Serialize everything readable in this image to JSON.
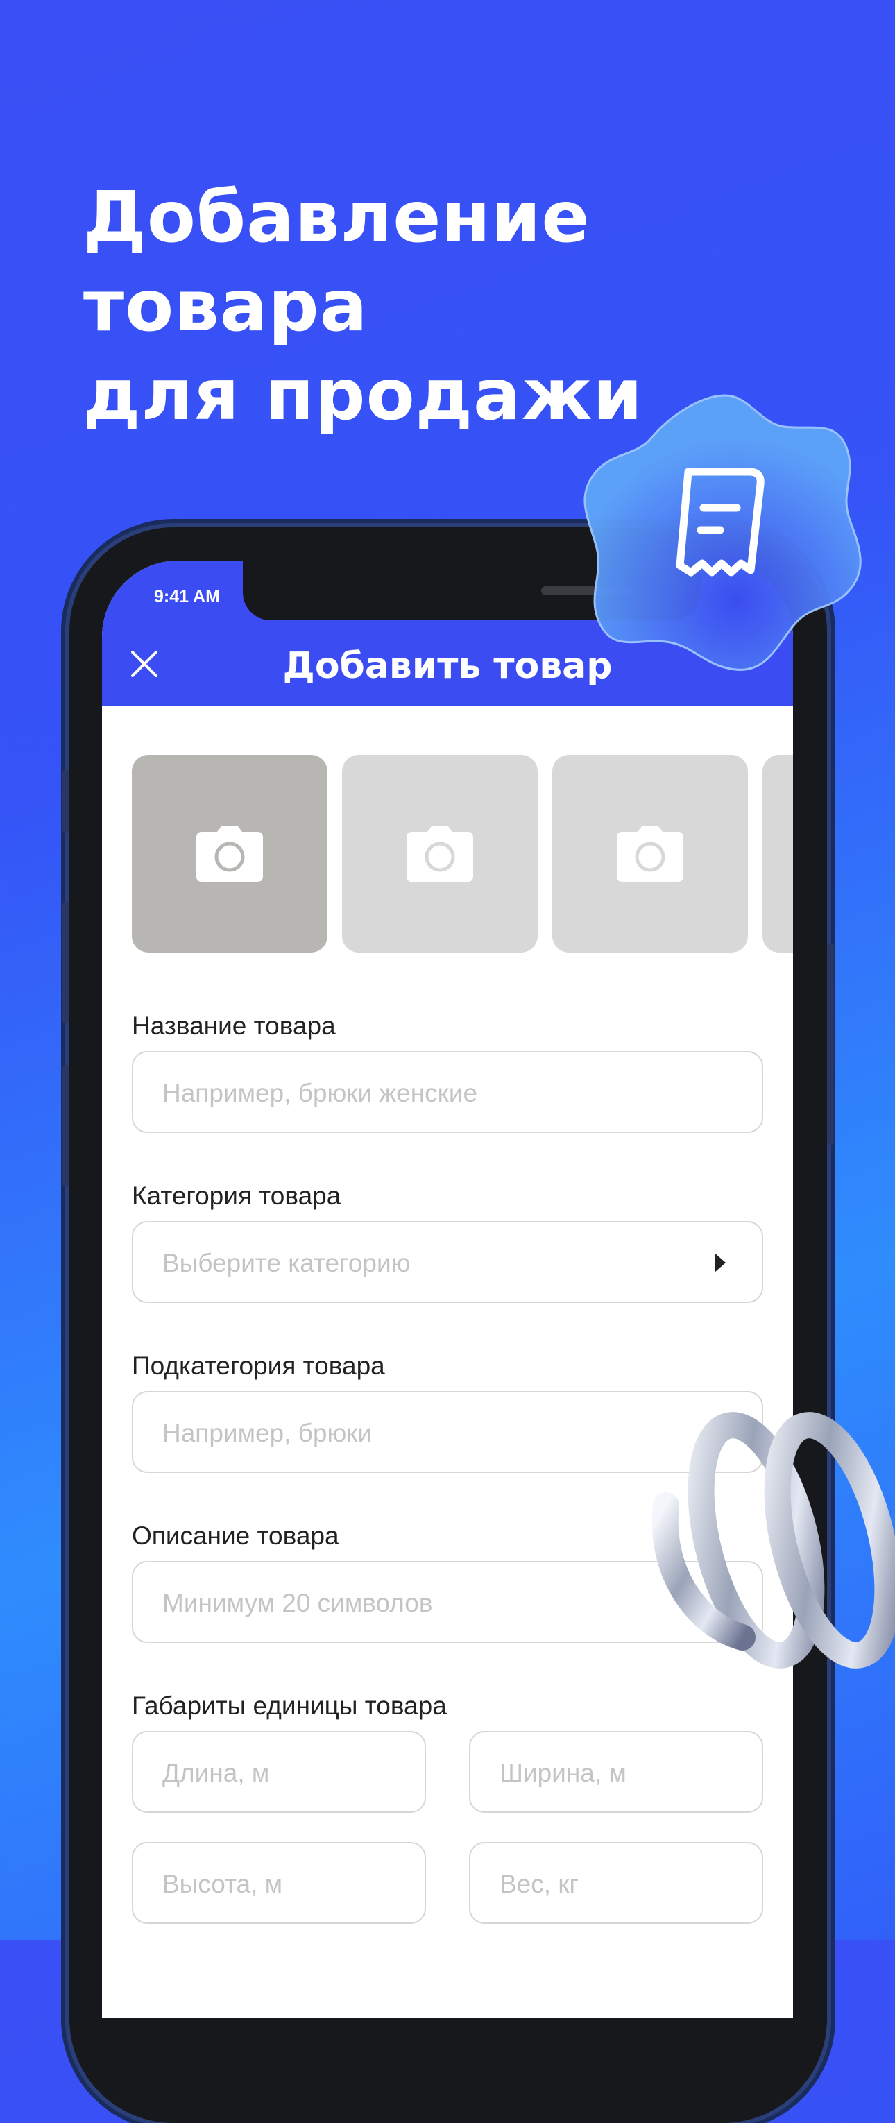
{
  "headline": [
    "Добавление товара",
    "для продажи"
  ],
  "status": {
    "time": "9:41 AM"
  },
  "nav": {
    "title": "Добавить товар",
    "close_icon": "close-icon"
  },
  "photos": {
    "slots": 4,
    "icon": "camera-icon"
  },
  "form": {
    "name": {
      "label": "Название товара",
      "placeholder": "Например, брюки женские"
    },
    "category": {
      "label": "Категория товара",
      "placeholder": "Выберите категорию"
    },
    "subcategory": {
      "label": "Подкатегория товара",
      "placeholder": "Например, брюки"
    },
    "description": {
      "label": "Описание товара",
      "placeholder": "Минимум 20 символов"
    },
    "dimensions": {
      "label": "Габариты единицы товара",
      "length": "Длина, м",
      "width": "Ширина, м",
      "height": "Высота, м",
      "weight": "Вес, кг"
    }
  },
  "colors": {
    "brand_blue": "#3b4cf2",
    "field_border": "#d6d6d6",
    "placeholder": "#c4c4c4"
  },
  "decor": {
    "badge_icon": "receipt-icon",
    "spring": "spring-decoration"
  }
}
